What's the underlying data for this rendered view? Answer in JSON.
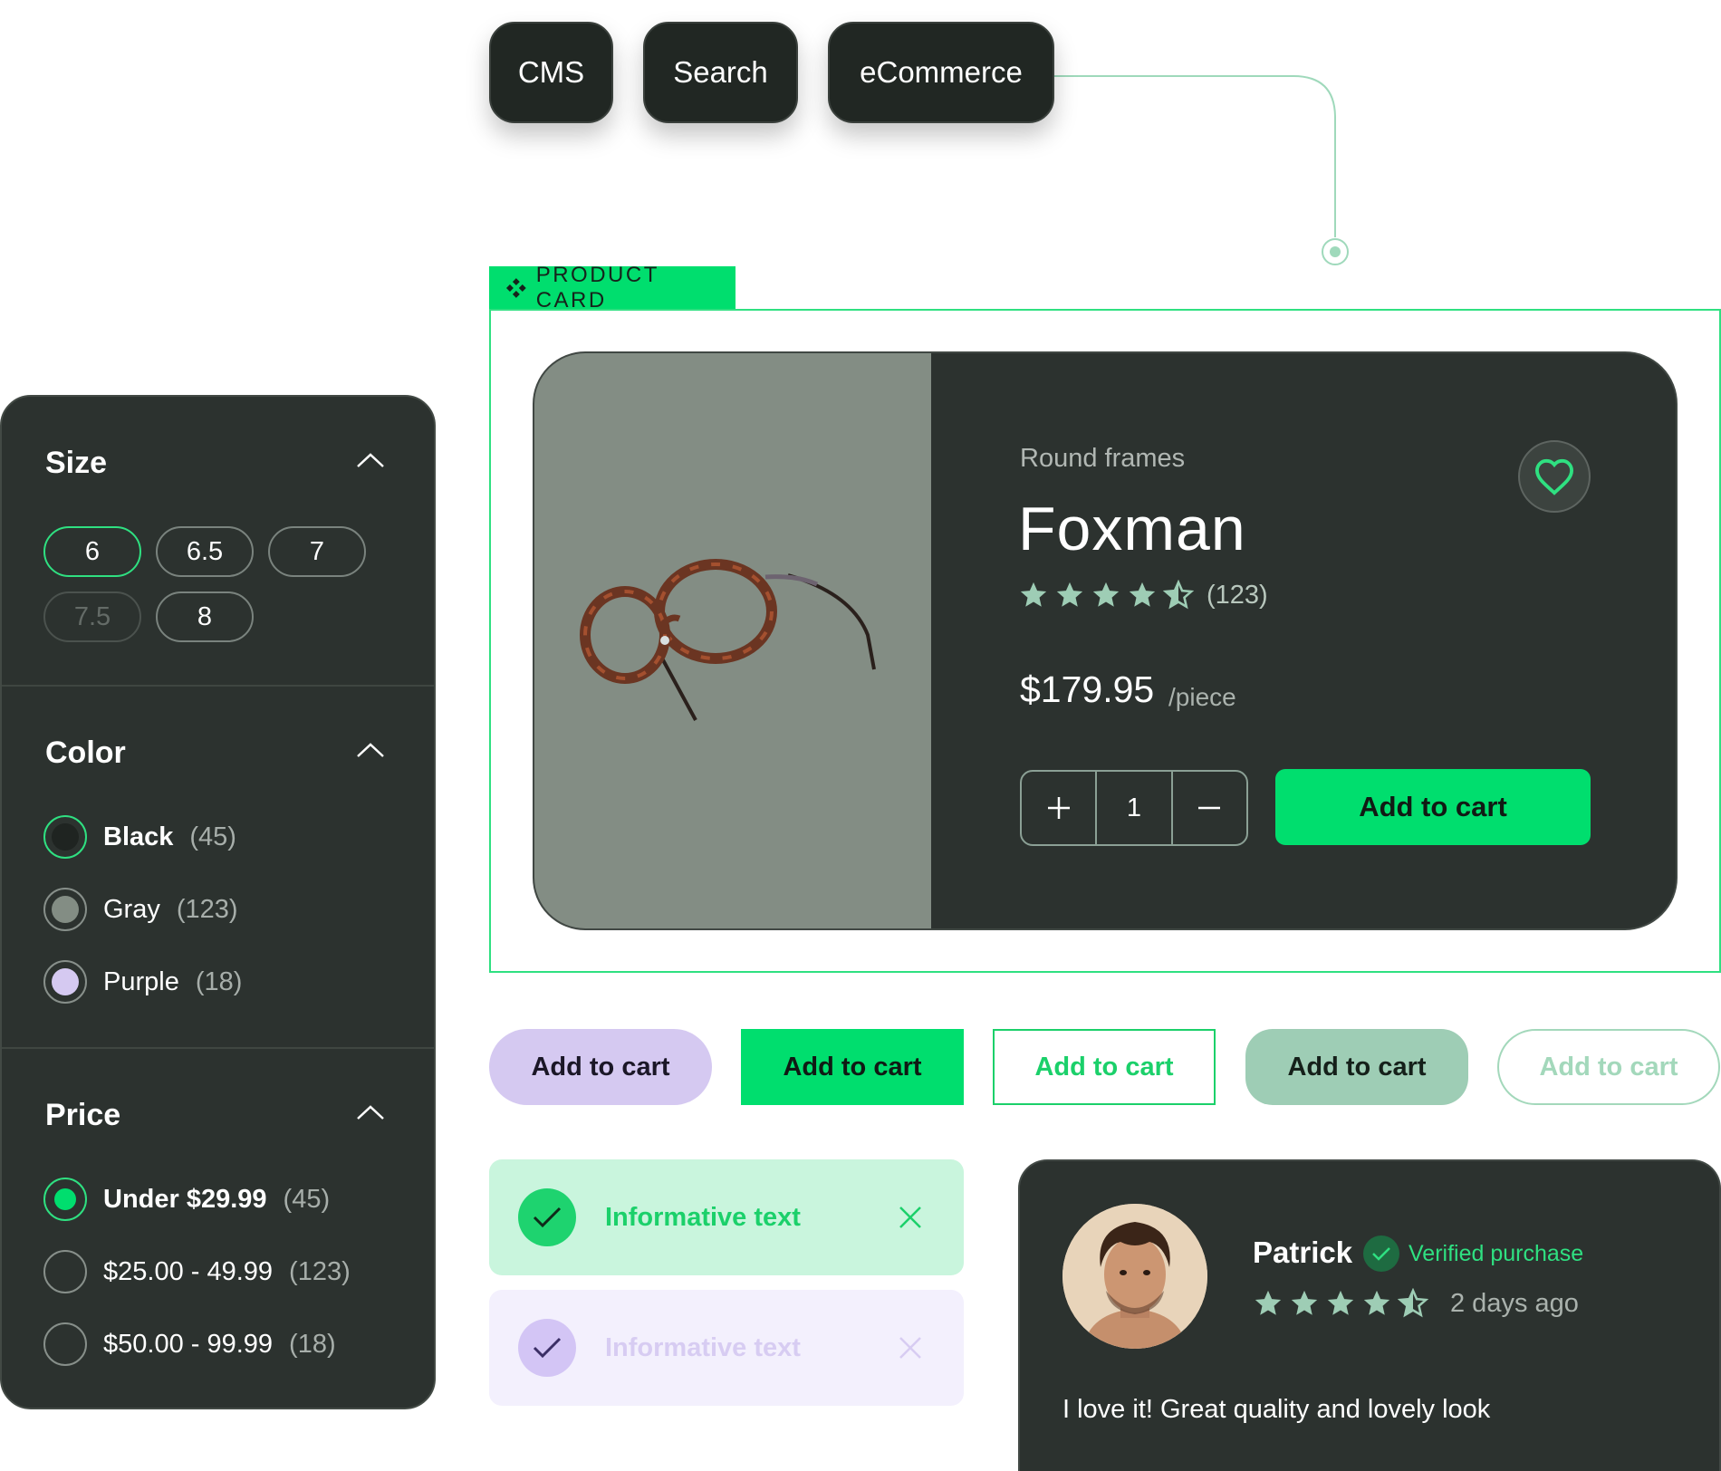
{
  "top_pills": [
    "CMS",
    "Search",
    "eCommerce"
  ],
  "product_card_tag": "PRODUCT CARD",
  "product": {
    "subtitle": "Round frames",
    "title": "Foxman",
    "rating": 4.5,
    "rating_count": "(123)",
    "price": "$179.95",
    "price_unit": "/piece",
    "quantity": "1",
    "add_to_cart": "Add to cart"
  },
  "filters": {
    "size": {
      "title": "Size",
      "options": [
        {
          "label": "6",
          "state": "selected"
        },
        {
          "label": "6.5",
          "state": "default"
        },
        {
          "label": "7",
          "state": "default"
        },
        {
          "label": "7.5",
          "state": "disabled"
        },
        {
          "label": "8",
          "state": "default"
        }
      ]
    },
    "color": {
      "title": "Color",
      "options": [
        {
          "label": "Black",
          "count": "(45)",
          "swatch": "#1f2421",
          "selected": true
        },
        {
          "label": "Gray",
          "count": "(123)",
          "swatch": "#838d84",
          "selected": false
        },
        {
          "label": "Purple",
          "count": "(18)",
          "swatch": "#d5c9f1",
          "selected": false
        }
      ]
    },
    "price": {
      "title": "Price",
      "options": [
        {
          "label": "Under $29.99",
          "count": "(45)",
          "selected": true
        },
        {
          "label": "$25.00 - 49.99",
          "count": "(123)",
          "selected": false
        },
        {
          "label": "$50.00 - 99.99",
          "count": "(18)",
          "selected": false
        }
      ]
    }
  },
  "button_variants": [
    "Add to cart",
    "Add to cart",
    "Add to cart",
    "Add to cart",
    "Add to cart"
  ],
  "alerts": [
    {
      "text": "Informative text",
      "variant": "success"
    },
    {
      "text": "Informative text",
      "variant": "info-disabled"
    }
  ],
  "review": {
    "name": "Patrick",
    "verified": "Verified purchase",
    "rating": 4.5,
    "time_ago": "2 days ago",
    "text": "I love it! Great quality and lovely look"
  },
  "colors": {
    "accent": "#00de6e",
    "dark_surface": "#2c322f",
    "lavender": "#d5c9f1",
    "sage": "#9ecdb5"
  },
  "icons": [
    "chevron-up-icon",
    "heart-icon",
    "star-icon",
    "star-half-icon",
    "plus-icon",
    "minus-icon",
    "check-icon",
    "close-icon",
    "component-icon"
  ]
}
